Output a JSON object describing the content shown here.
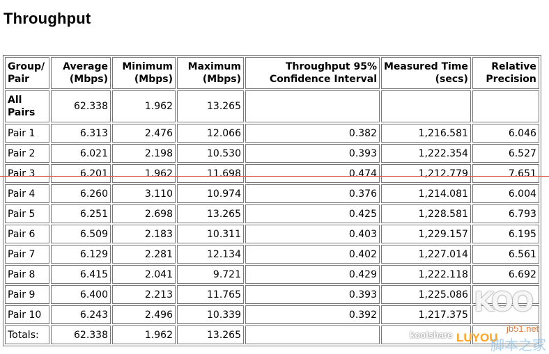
{
  "title": "Throughput",
  "headers": [
    [
      "Group/",
      "Pair"
    ],
    [
      "Average",
      "(Mbps)"
    ],
    [
      "Minimum",
      "(Mbps)"
    ],
    [
      "Maximum",
      "(Mbps)"
    ],
    [
      "Throughput 95%",
      "Confidence Interval"
    ],
    [
      "Measured Time",
      "(secs)"
    ],
    [
      "Relative",
      "Precision"
    ]
  ],
  "all_pairs": {
    "label": [
      "All",
      "Pairs"
    ],
    "average": "62.338",
    "minimum": "1.962",
    "maximum": "13.265"
  },
  "rows": [
    {
      "pair": "Pair 1",
      "avg": "6.313",
      "min": "2.476",
      "max": "12.066",
      "ci": "0.382",
      "time": "1,216.581",
      "rp": "6.046"
    },
    {
      "pair": "Pair 2",
      "avg": "6.021",
      "min": "2.198",
      "max": "10.530",
      "ci": "0.393",
      "time": "1,222.354",
      "rp": "6.527"
    },
    {
      "pair": "Pair 3",
      "avg": "6.201",
      "min": "1.962",
      "max": "11.698",
      "ci": "0.474",
      "time": "1,212.779",
      "rp": "7.651"
    },
    {
      "pair": "Pair 4",
      "avg": "6.260",
      "min": "3.110",
      "max": "10.974",
      "ci": "0.376",
      "time": "1,214.081",
      "rp": "6.004"
    },
    {
      "pair": "Pair 5",
      "avg": "6.251",
      "min": "2.698",
      "max": "13.265",
      "ci": "0.425",
      "time": "1,228.581",
      "rp": "6.793"
    },
    {
      "pair": "Pair 6",
      "avg": "6.509",
      "min": "2.183",
      "max": "10.311",
      "ci": "0.403",
      "time": "1,229.157",
      "rp": "6.195"
    },
    {
      "pair": "Pair 7",
      "avg": "6.129",
      "min": "2.281",
      "max": "12.134",
      "ci": "0.402",
      "time": "1,227.014",
      "rp": "6.561"
    },
    {
      "pair": "Pair 8",
      "avg": "6.415",
      "min": "2.041",
      "max": "9.721",
      "ci": "0.429",
      "time": "1,222.118",
      "rp": "6.692"
    },
    {
      "pair": "Pair 9",
      "avg": "6.400",
      "min": "2.213",
      "max": "11.765",
      "ci": "0.393",
      "time": "1,225.086",
      "rp": ""
    },
    {
      "pair": "Pair 10",
      "avg": "6.243",
      "min": "2.496",
      "max": "10.339",
      "ci": "0.392",
      "time": "1,217.375",
      "rp": ""
    }
  ],
  "totals": {
    "label": "Totals:",
    "average": "62.338",
    "minimum": "1.962",
    "maximum": "13.265"
  },
  "watermarks": {
    "koo": "KOO",
    "jb51": "jb51.net",
    "koolshare": "koolshare",
    "luyou": "LUYOU",
    "cn": "脚本之家"
  }
}
